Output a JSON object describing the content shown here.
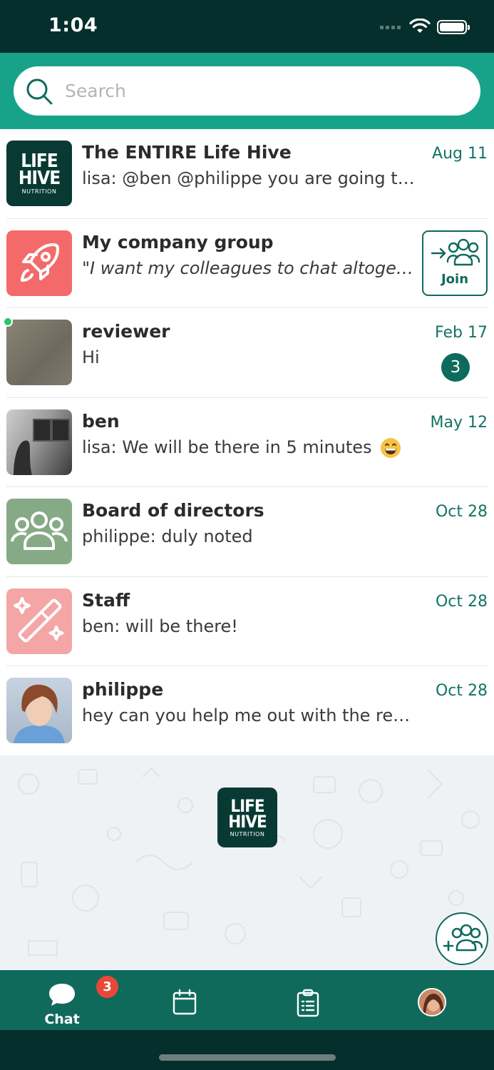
{
  "status_bar": {
    "time": "1:04"
  },
  "search": {
    "placeholder": "Search"
  },
  "chats": [
    {
      "title": "The ENTIRE Life Hive",
      "preview": "lisa: @ben @philippe you are going to li...",
      "date": "Aug 11",
      "avatar": "lifehive-logo"
    },
    {
      "title": "My company group",
      "preview": "\"I want my colleagues to chat altogeth...",
      "action": "Join",
      "avatar": "rocket-icon"
    },
    {
      "title": "reviewer",
      "preview": "Hi",
      "date": "Feb 17",
      "unread": "3",
      "online": true,
      "avatar": "photo"
    },
    {
      "title": "ben",
      "preview": "lisa: We will be there in 5 minutes",
      "date": "May 12",
      "avatar": "photo",
      "emoji": "grinning-face"
    },
    {
      "title": "Board of directors",
      "preview": "philippe: duly noted",
      "date": "Oct 28",
      "avatar": "group-icon"
    },
    {
      "title": "Staff",
      "preview": "ben: will be there!",
      "date": "Oct 28",
      "avatar": "magic-wand-icon"
    },
    {
      "title": "philippe",
      "preview": "hey can you help me out with the report?",
      "date": "Oct 28",
      "avatar": "photo"
    }
  ],
  "brand": {
    "logo_line1": "LIFE",
    "logo_line2": "HIVE",
    "logo_sub": "NUTRITION"
  },
  "tabs": [
    {
      "label": "Chat",
      "icon": "chat-bubble-icon",
      "badge": "3",
      "active": true
    },
    {
      "label": "",
      "icon": "calendar-icon"
    },
    {
      "label": "",
      "icon": "clipboard-icon"
    },
    {
      "label": "",
      "icon": "profile-avatar"
    }
  ],
  "colors": {
    "header": "#052f2c",
    "accent": "#17a38a",
    "tabbar": "#0f6a5c",
    "date_text": "#137464",
    "badge_red": "#e8483a",
    "online": "#2ec36b"
  }
}
